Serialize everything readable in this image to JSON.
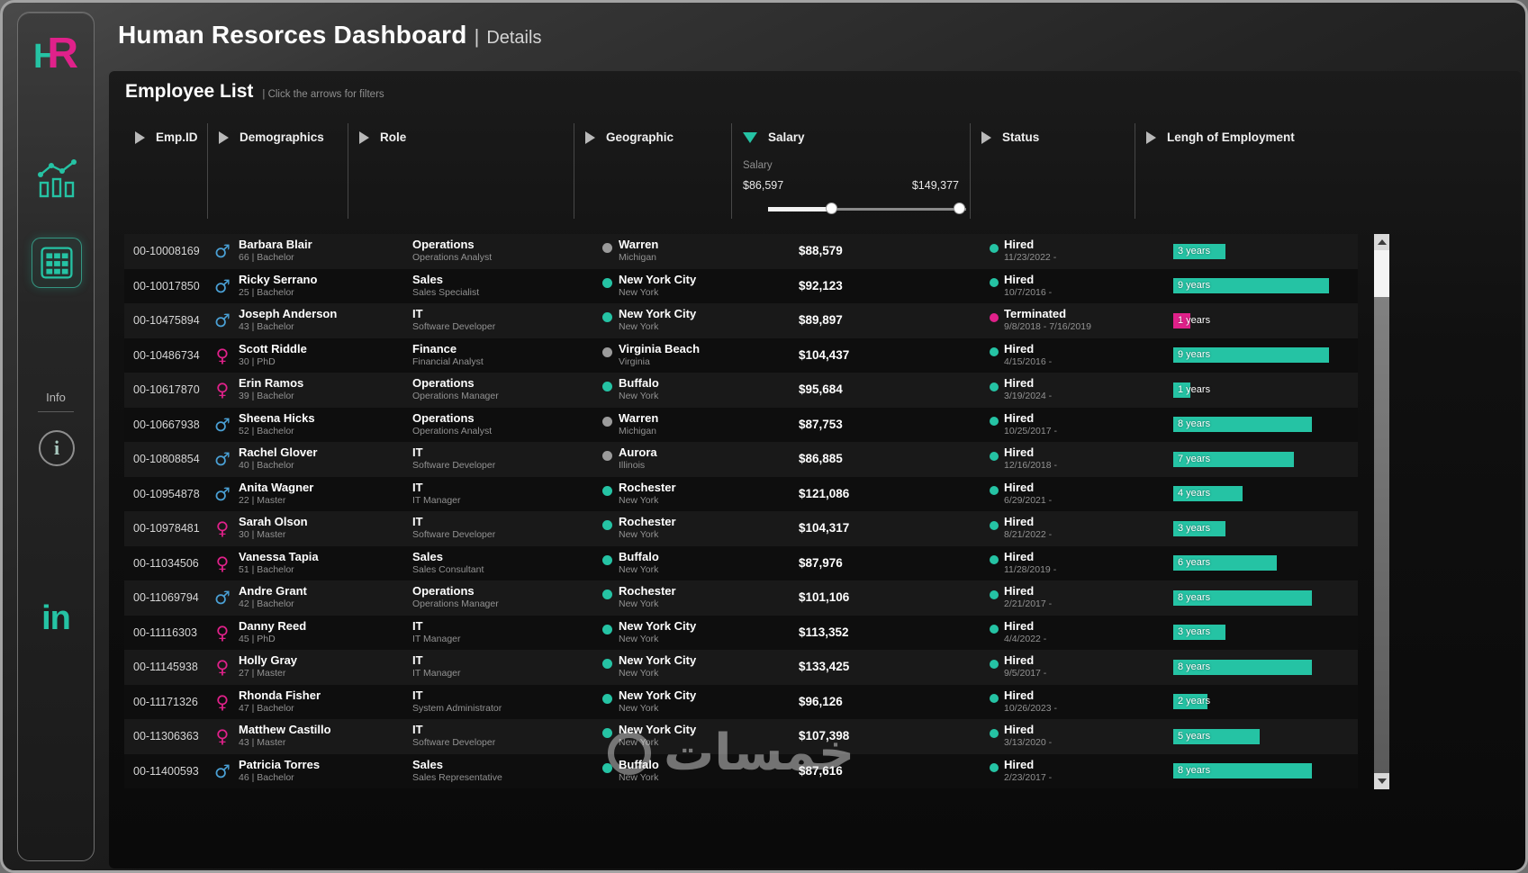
{
  "header": {
    "title": "Human Resorces Dashboard",
    "divider": "|",
    "subtitle": "Details"
  },
  "sidebar": {
    "logo_h": "H",
    "logo_r": "R",
    "info_label": "Info",
    "info_icon_glyph": "i",
    "linkedin_label": "in"
  },
  "panel": {
    "title": "Employee List",
    "hint": "|  Click the arrows for filters"
  },
  "filters": [
    {
      "label": "Emp.ID",
      "expanded": false
    },
    {
      "label": "Demographics",
      "expanded": false
    },
    {
      "label": "Role",
      "expanded": false
    },
    {
      "label": "Geographic",
      "expanded": false
    },
    {
      "label": "Salary",
      "expanded": true,
      "sub_label": "Salary",
      "min": "$86,597",
      "max": "$149,377"
    },
    {
      "label": "Status",
      "expanded": false
    },
    {
      "label": "Lengh of Employment",
      "expanded": false
    }
  ],
  "icons": {
    "male": "♂",
    "female": "♀"
  },
  "colors": {
    "teal": "#25c3a4",
    "magenta": "#e0218a",
    "male": "#4aa0d5",
    "graydot": "#9b9b9b"
  },
  "watermark": {
    "text": "خمسات"
  },
  "employees": [
    {
      "id": "00-10008169",
      "gender": "male",
      "name": "Barbara Blair",
      "detail": "66  | Bachelor",
      "dept": "Operations",
      "role": "Operations Analyst",
      "city": "Warren",
      "state": "Michigan",
      "city_dot": "gray",
      "salary": "$88,579",
      "status": "Hired",
      "dates": "11/23/2022 -",
      "years": 3,
      "years_label": "3 years"
    },
    {
      "id": "00-10017850",
      "gender": "male",
      "name": "Ricky Serrano",
      "detail": "25  | Bachelor",
      "dept": "Sales",
      "role": "Sales Specialist",
      "city": "New York City",
      "state": "New York",
      "city_dot": "teal",
      "salary": "$92,123",
      "status": "Hired",
      "dates": "10/7/2016 -",
      "years": 9,
      "years_label": "9 years"
    },
    {
      "id": "00-10475894",
      "gender": "male",
      "name": "Joseph Anderson",
      "detail": "43  | Bachelor",
      "dept": "IT",
      "role": "Software Developer",
      "city": "New York City",
      "state": "New York",
      "city_dot": "teal",
      "salary": "$89,897",
      "status": "Terminated",
      "dates": "9/8/2018 - 7/16/2019",
      "years": 1,
      "years_label": "1 years"
    },
    {
      "id": "00-10486734",
      "gender": "female",
      "name": "Scott Riddle",
      "detail": "30  | PhD",
      "dept": "Finance",
      "role": "Financial Analyst",
      "city": "Virginia Beach",
      "state": "Virginia",
      "city_dot": "gray",
      "salary": "$104,437",
      "status": "Hired",
      "dates": "4/15/2016 -",
      "years": 9,
      "years_label": "9 years"
    },
    {
      "id": "00-10617870",
      "gender": "female",
      "name": "Erin Ramos",
      "detail": "39  | Bachelor",
      "dept": "Operations",
      "role": "Operations Manager",
      "city": "Buffalo",
      "state": "New York",
      "city_dot": "teal",
      "salary": "$95,684",
      "status": "Hired",
      "dates": "3/19/2024 -",
      "years": 1,
      "years_label": "1 years"
    },
    {
      "id": "00-10667938",
      "gender": "male",
      "name": "Sheena Hicks",
      "detail": "52  | Bachelor",
      "dept": "Operations",
      "role": "Operations Analyst",
      "city": "Warren",
      "state": "Michigan",
      "city_dot": "gray",
      "salary": "$87,753",
      "status": "Hired",
      "dates": "10/25/2017 -",
      "years": 8,
      "years_label": "8 years"
    },
    {
      "id": "00-10808854",
      "gender": "male",
      "name": "Rachel Glover",
      "detail": "40  | Bachelor",
      "dept": "IT",
      "role": "Software Developer",
      "city": "Aurora",
      "state": "Illinois",
      "city_dot": "gray",
      "salary": "$86,885",
      "status": "Hired",
      "dates": "12/16/2018 -",
      "years": 7,
      "years_label": "7 years"
    },
    {
      "id": "00-10954878",
      "gender": "male",
      "name": "Anita Wagner",
      "detail": "22  | Master",
      "dept": "IT",
      "role": "IT Manager",
      "city": "Rochester",
      "state": "New York",
      "city_dot": "teal",
      "salary": "$121,086",
      "status": "Hired",
      "dates": "6/29/2021 -",
      "years": 4,
      "years_label": "4 years"
    },
    {
      "id": "00-10978481",
      "gender": "female",
      "name": "Sarah Olson",
      "detail": "30  | Master",
      "dept": "IT",
      "role": "Software Developer",
      "city": "Rochester",
      "state": "New York",
      "city_dot": "teal",
      "salary": "$104,317",
      "status": "Hired",
      "dates": "8/21/2022 -",
      "years": 3,
      "years_label": "3 years"
    },
    {
      "id": "00-11034506",
      "gender": "female",
      "name": "Vanessa Tapia",
      "detail": "51  | Bachelor",
      "dept": "Sales",
      "role": "Sales Consultant",
      "city": "Buffalo",
      "state": "New York",
      "city_dot": "teal",
      "salary": "$87,976",
      "status": "Hired",
      "dates": "11/28/2019 -",
      "years": 6,
      "years_label": "6 years"
    },
    {
      "id": "00-11069794",
      "gender": "male",
      "name": "Andre Grant",
      "detail": "42  | Bachelor",
      "dept": "Operations",
      "role": "Operations Manager",
      "city": "Rochester",
      "state": "New York",
      "city_dot": "teal",
      "salary": "$101,106",
      "status": "Hired",
      "dates": "2/21/2017 -",
      "years": 8,
      "years_label": "8 years"
    },
    {
      "id": "00-11116303",
      "gender": "female",
      "name": "Danny Reed",
      "detail": "45  | PhD",
      "dept": "IT",
      "role": "IT Manager",
      "city": "New York City",
      "state": "New York",
      "city_dot": "teal",
      "salary": "$113,352",
      "status": "Hired",
      "dates": "4/4/2022 -",
      "years": 3,
      "years_label": "3 years"
    },
    {
      "id": "00-11145938",
      "gender": "female",
      "name": "Holly Gray",
      "detail": "27  | Master",
      "dept": "IT",
      "role": "IT Manager",
      "city": "New York City",
      "state": "New York",
      "city_dot": "teal",
      "salary": "$133,425",
      "status": "Hired",
      "dates": "9/5/2017 -",
      "years": 8,
      "years_label": "8 years"
    },
    {
      "id": "00-11171326",
      "gender": "female",
      "name": "Rhonda Fisher",
      "detail": "47  | Bachelor",
      "dept": "IT",
      "role": "System Administrator",
      "city": "New York City",
      "state": "New York",
      "city_dot": "teal",
      "salary": "$96,126",
      "status": "Hired",
      "dates": "10/26/2023 -",
      "years": 2,
      "years_label": "2 years"
    },
    {
      "id": "00-11306363",
      "gender": "female",
      "name": "Matthew Castillo",
      "detail": "43  | Master",
      "dept": "IT",
      "role": "Software Developer",
      "city": "New York City",
      "state": "New York",
      "city_dot": "teal",
      "salary": "$107,398",
      "status": "Hired",
      "dates": "3/13/2020 -",
      "years": 5,
      "years_label": "5 years"
    },
    {
      "id": "00-11400593",
      "gender": "male",
      "name": "Patricia Torres",
      "detail": "46  | Bachelor",
      "dept": "Sales",
      "role": "Sales Representative",
      "city": "Buffalo",
      "state": "New York",
      "city_dot": "teal",
      "salary": "$87,616",
      "status": "Hired",
      "dates": "2/23/2017 -",
      "years": 8,
      "years_label": "8 years"
    }
  ]
}
